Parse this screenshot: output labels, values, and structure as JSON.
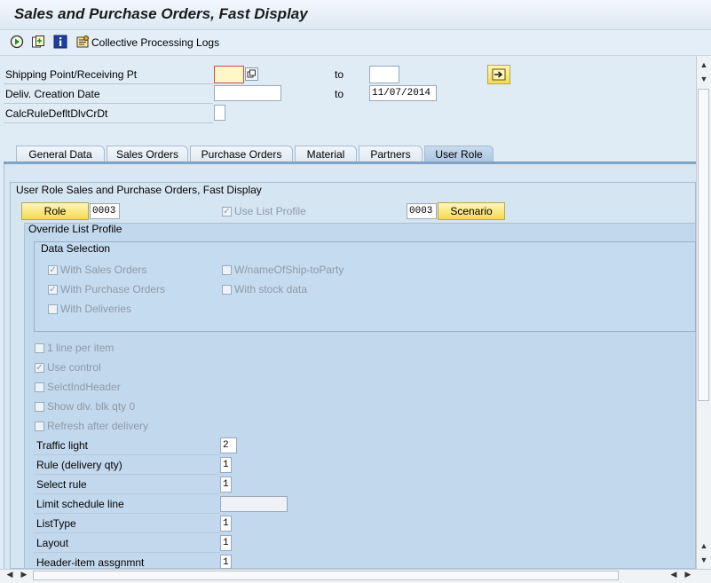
{
  "window": {
    "title": "Sales and Purchase Orders, Fast Display"
  },
  "toolbar": {
    "icons": [
      "execute-icon",
      "get-variant-icon",
      "info-icon",
      "logs-icon"
    ],
    "logs_label": "Collective Processing Logs"
  },
  "selection": {
    "shipping_point_label": "Shipping Point/Receiving Pt",
    "shipping_point_value": "",
    "to_label_1": "to",
    "shipping_point_to_value": "",
    "deliv_date_label": "Deliv. Creation Date",
    "deliv_date_from_value": "",
    "to_label_2": "to",
    "deliv_date_to_value": "11/07/2014",
    "calcrule_label": "CalcRuleDefltDlvCrDt"
  },
  "tabs": [
    "General Data",
    "Sales Orders",
    "Purchase Orders",
    "Material",
    "Partners",
    "User Role"
  ],
  "active_tab": "User Role",
  "user_role": {
    "group_title": "User Role Sales and Purchase Orders, Fast Display",
    "role_button": "Role",
    "role_value": "0003",
    "use_list_profile_label": "Use List Profile",
    "scenario_value": "0003",
    "scenario_button": "Scenario",
    "override_title": "Override List Profile",
    "data_selection_title": "Data Selection",
    "checks": {
      "with_sales_orders": "With Sales Orders",
      "with_purchase_orders": "With Purchase Orders",
      "with_deliveries": "With Deliveries",
      "w_name_ship_to": "W/nameOfShip-toParty",
      "with_stock_data": "With stock data",
      "one_line_per_item": "1 line per item",
      "use_control": "Use control",
      "selct_ind_header": "SelctIndHeader",
      "show_dlv_blk": "Show dlv. blk qty 0",
      "refresh_after": "Refresh after delivery"
    },
    "fields": {
      "traffic_light_label": "Traffic light",
      "traffic_light_value": "2",
      "rule_label": "Rule (delivery qty)",
      "rule_value": "1",
      "select_rule_label": "Select rule",
      "select_rule_value": "1",
      "limit_label": "Limit schedule line",
      "limit_value": "",
      "listtype_label": "ListType",
      "listtype_value": "1",
      "layout_label": "Layout",
      "layout_value": "1",
      "header_item_label": "Header-item assgnmnt",
      "header_item_value": "1"
    }
  }
}
